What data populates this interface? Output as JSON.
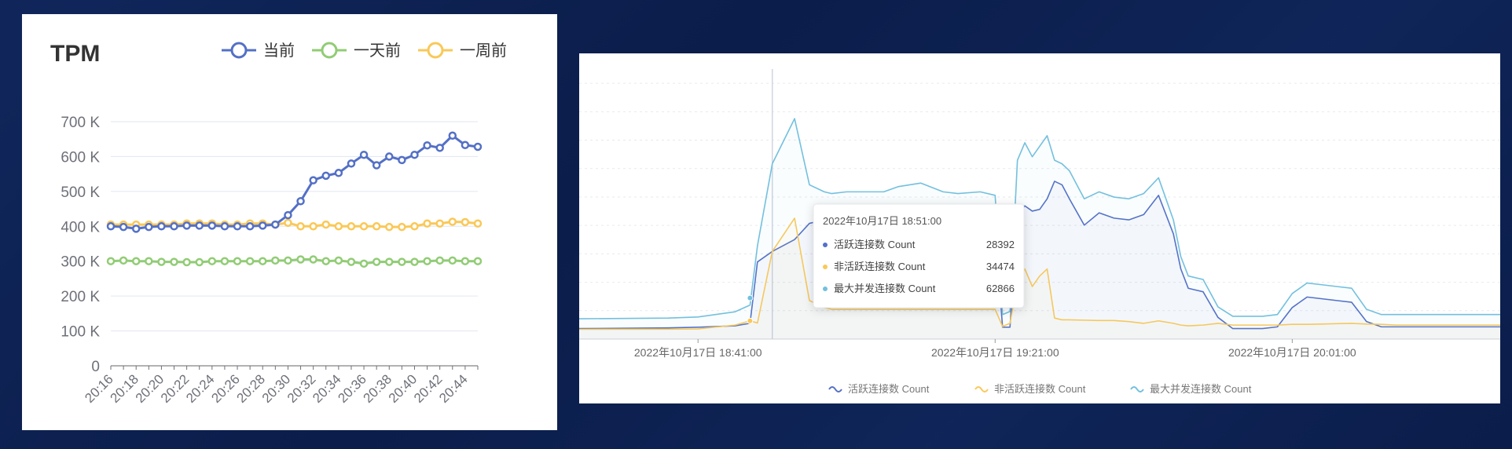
{
  "chart_data": [
    {
      "type": "line",
      "title": "TPM",
      "ylim": [
        0,
        700
      ],
      "yticks": [
        "0",
        "100 K",
        "200 K",
        "300 K",
        "400 K",
        "500 K",
        "600 K",
        "700 K"
      ],
      "ytick_values": [
        0,
        100,
        200,
        300,
        400,
        500,
        600,
        700
      ],
      "x": [
        "20:16",
        "20:17",
        "20:18",
        "20:19",
        "20:20",
        "20:21",
        "20:22",
        "20:23",
        "20:24",
        "20:25",
        "20:26",
        "20:27",
        "20:28",
        "20:29",
        "20:30",
        "20:31",
        "20:32",
        "20:33",
        "20:34",
        "20:35",
        "20:36",
        "20:37",
        "20:38",
        "20:39",
        "20:40",
        "20:41",
        "20:42",
        "20:43",
        "20:44",
        "20:45"
      ],
      "xtick_labels": [
        "20:16",
        "20:18",
        "20:20",
        "20:22",
        "20:24",
        "20:26",
        "20:28",
        "20:30",
        "20:32",
        "20:34",
        "20:36",
        "20:38",
        "20:40",
        "20:42",
        "20:44"
      ],
      "series": [
        {
          "name": "当前",
          "color": "#5470c6",
          "values": [
            400,
            398,
            393,
            398,
            400,
            400,
            402,
            402,
            402,
            400,
            400,
            400,
            402,
            405,
            432,
            472,
            532,
            545,
            553,
            580,
            605,
            575,
            600,
            590,
            605,
            632,
            625,
            660,
            633,
            628
          ]
        },
        {
          "name": "一天前",
          "color": "#91cc75",
          "values": [
            300,
            302,
            300,
            300,
            298,
            298,
            297,
            297,
            300,
            300,
            300,
            300,
            300,
            302,
            302,
            305,
            305,
            300,
            302,
            298,
            293,
            298,
            298,
            298,
            298,
            300,
            302,
            302,
            300,
            300
          ]
        },
        {
          "name": "一周前",
          "color": "#fac858",
          "values": [
            405,
            405,
            405,
            405,
            405,
            405,
            408,
            408,
            408,
            405,
            405,
            408,
            408,
            405,
            410,
            400,
            400,
            405,
            400,
            400,
            400,
            400,
            398,
            398,
            400,
            408,
            408,
            413,
            412,
            408
          ]
        }
      ],
      "legend_position": "top-right",
      "grid": true
    },
    {
      "type": "area",
      "x_labels": [
        "2022年10月17日 18:41:00",
        "2022年10月17日 19:21:00",
        "2022年10月17日 20:01:00"
      ],
      "x_minutes": [
        -16,
        -4,
        0,
        5,
        7,
        8,
        10,
        13,
        15,
        17,
        18,
        20,
        25,
        27,
        30,
        33,
        35,
        38,
        40,
        41,
        42,
        43,
        44,
        45,
        46,
        47,
        48,
        49,
        50,
        52,
        54,
        56,
        58,
        60,
        62,
        64,
        65,
        66,
        68,
        70,
        72,
        74,
        76,
        78,
        80,
        82,
        84,
        86,
        88,
        90,
        92,
        94,
        96,
        98,
        100,
        102,
        104,
        106,
        108
      ],
      "series": [
        {
          "name": "活跃连接数 Count",
          "color": "#5470c6",
          "values": [
            3000,
            3200,
            3400,
            3800,
            4500,
            22000,
            25000,
            28392,
            33000,
            34000,
            33500,
            33500,
            34000,
            35500,
            36000,
            33800,
            33000,
            34000,
            32000,
            3400,
            3400,
            35000,
            38000,
            36500,
            37000,
            40000,
            45000,
            44000,
            40000,
            32500,
            36000,
            34500,
            34000,
            35500,
            41000,
            30000,
            20000,
            14500,
            13500,
            6200,
            3000,
            3000,
            3000,
            3500,
            9000,
            12000,
            11500,
            11000,
            10500,
            5000,
            3500,
            3500,
            3500,
            3500,
            3500,
            3500,
            3500,
            3500,
            3500
          ]
        },
        {
          "name": "非活跃连接数 Count",
          "color": "#fac858",
          "values": [
            2800,
            2850,
            2900,
            4000,
            5200,
            4600,
            25000,
            34474,
            11000,
            9000,
            8500,
            8500,
            8500,
            8500,
            8500,
            8500,
            8500,
            8500,
            8500,
            3600,
            4500,
            16000,
            20000,
            15000,
            18000,
            20000,
            6000,
            5500,
            5500,
            5400,
            5300,
            5300,
            5000,
            4500,
            5200,
            4500,
            4000,
            3800,
            4000,
            4500,
            4000,
            4000,
            4000,
            4000,
            4200,
            4200,
            4300,
            4400,
            4500,
            4300,
            4200,
            4000,
            4000,
            4000,
            4000,
            4000,
            4000,
            4000,
            4000
          ]
        },
        {
          "name": "最大并发连接数 Count",
          "color": "#73c0de",
          "values": [
            5800,
            6000,
            6300,
            7800,
            9700,
            26600,
            50000,
            62866,
            44000,
            42000,
            41500,
            42000,
            42000,
            43500,
            44500,
            42000,
            41500,
            42000,
            41000,
            7000,
            7900,
            51000,
            56000,
            52000,
            55000,
            58000,
            51000,
            50000,
            48000,
            40000,
            42000,
            40500,
            40000,
            41500,
            46000,
            34000,
            23500,
            18000,
            17000,
            9200,
            6500,
            6500,
            6500,
            7000,
            13000,
            16000,
            15500,
            15000,
            14500,
            8500,
            7000,
            7000,
            7000,
            7000,
            7000,
            7000,
            7000,
            7000,
            7000
          ]
        }
      ],
      "tooltip": {
        "title": "2022年10月17日 18:51:00",
        "rows": [
          {
            "label": "活跃连接数 Count",
            "value": "28392",
            "color": "#5470c6"
          },
          {
            "label": "非活跃连接数 Count",
            "value": "34474",
            "color": "#fac858"
          },
          {
            "label": "最大并发连接数 Count",
            "value": "62866",
            "color": "#73c0de"
          }
        ]
      },
      "legend_position": "bottom",
      "grid": true
    }
  ]
}
